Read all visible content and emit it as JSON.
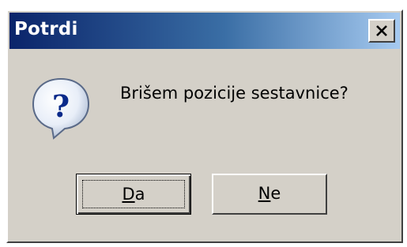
{
  "window": {
    "title": "Potrdi"
  },
  "dialog": {
    "message": "Brišem pozicije sestavnice?",
    "icon": "question-icon"
  },
  "buttons": {
    "yes": {
      "mnemonic": "D",
      "rest": "a"
    },
    "no": {
      "mnemonic": "N",
      "rest": "e"
    }
  },
  "colors": {
    "title_start": "#0a246a",
    "title_end": "#a6caf0",
    "face": "#d4d0c8"
  }
}
